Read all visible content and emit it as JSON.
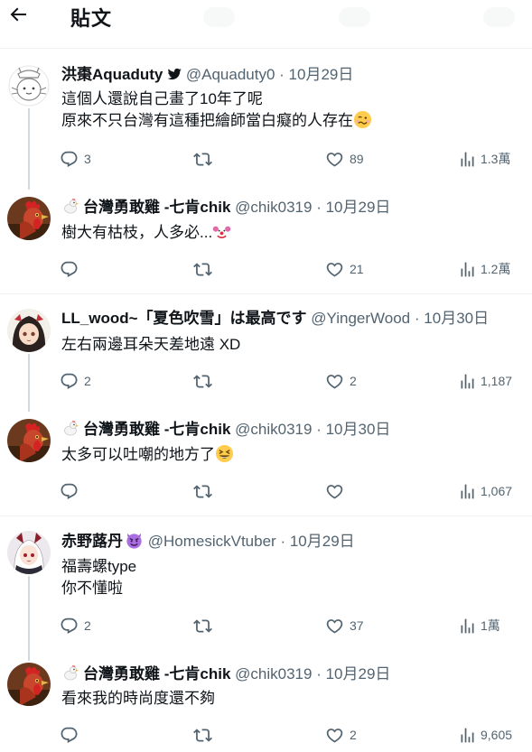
{
  "header": {
    "title": "貼文"
  },
  "tweets": [
    {
      "name": "洪棗Aquaduty",
      "handle": "@Aquaduty0",
      "sep": "·",
      "time": "10月29日",
      "lines": [
        "這個人還說自己畫了10年了呢",
        "原來不只台灣有這種把繪師當白癡的人存在"
      ],
      "replies": "3",
      "retweets": "",
      "likes": "89",
      "views": "1.3萬",
      "avatar": "white-character-avatar"
    },
    {
      "name": "台灣勇敢雞 -七肯chik",
      "handle": "@chik0319",
      "sep": "·",
      "time": "10月29日",
      "lines": [
        "樹大有枯枝，人多必..."
      ],
      "replies": "",
      "retweets": "",
      "likes": "21",
      "views": "1.2萬",
      "avatar": "rooster-avatar"
    },
    {
      "name": "LL_wood~「夏色吹雪」は最高です",
      "handle": "@YingerWood",
      "sep": "·",
      "time": "10月30日",
      "lines": [
        "左右兩邊耳朵天差地遠 XD"
      ],
      "replies": "2",
      "retweets": "",
      "likes": "2",
      "views": "1,187",
      "avatar": "anime-girl-avatar"
    },
    {
      "name": "台灣勇敢雞 -七肯chik",
      "handle": "@chik0319",
      "sep": "·",
      "time": "10月30日",
      "lines": [
        "太多可以吐嘲的地方了"
      ],
      "replies": "",
      "retweets": "",
      "likes": "",
      "views": "1,067",
      "avatar": "rooster-avatar"
    },
    {
      "name": "赤野蕗丹",
      "handle": "@HomesickVtuber",
      "sep": "·",
      "time": "10月29日",
      "lines": [
        "福壽螺type",
        "你不懂啦"
      ],
      "replies": "2",
      "retweets": "",
      "likes": "37",
      "views": "1萬",
      "avatar": "vtuber-avatar"
    },
    {
      "name": "台灣勇敢雞 -七肯chik",
      "handle": "@chik0319",
      "sep": "·",
      "time": "10月29日",
      "lines": [
        "看來我的時尚度還不夠"
      ],
      "replies": "",
      "retweets": "",
      "likes": "2",
      "views": "9,605",
      "avatar": "rooster-avatar"
    }
  ],
  "colors": {
    "text": "#0f1419",
    "secondary": "#536471",
    "thread_line": "#cfd9de",
    "divider": "#eff3f4",
    "verified_blue": "#1d9bf0"
  }
}
